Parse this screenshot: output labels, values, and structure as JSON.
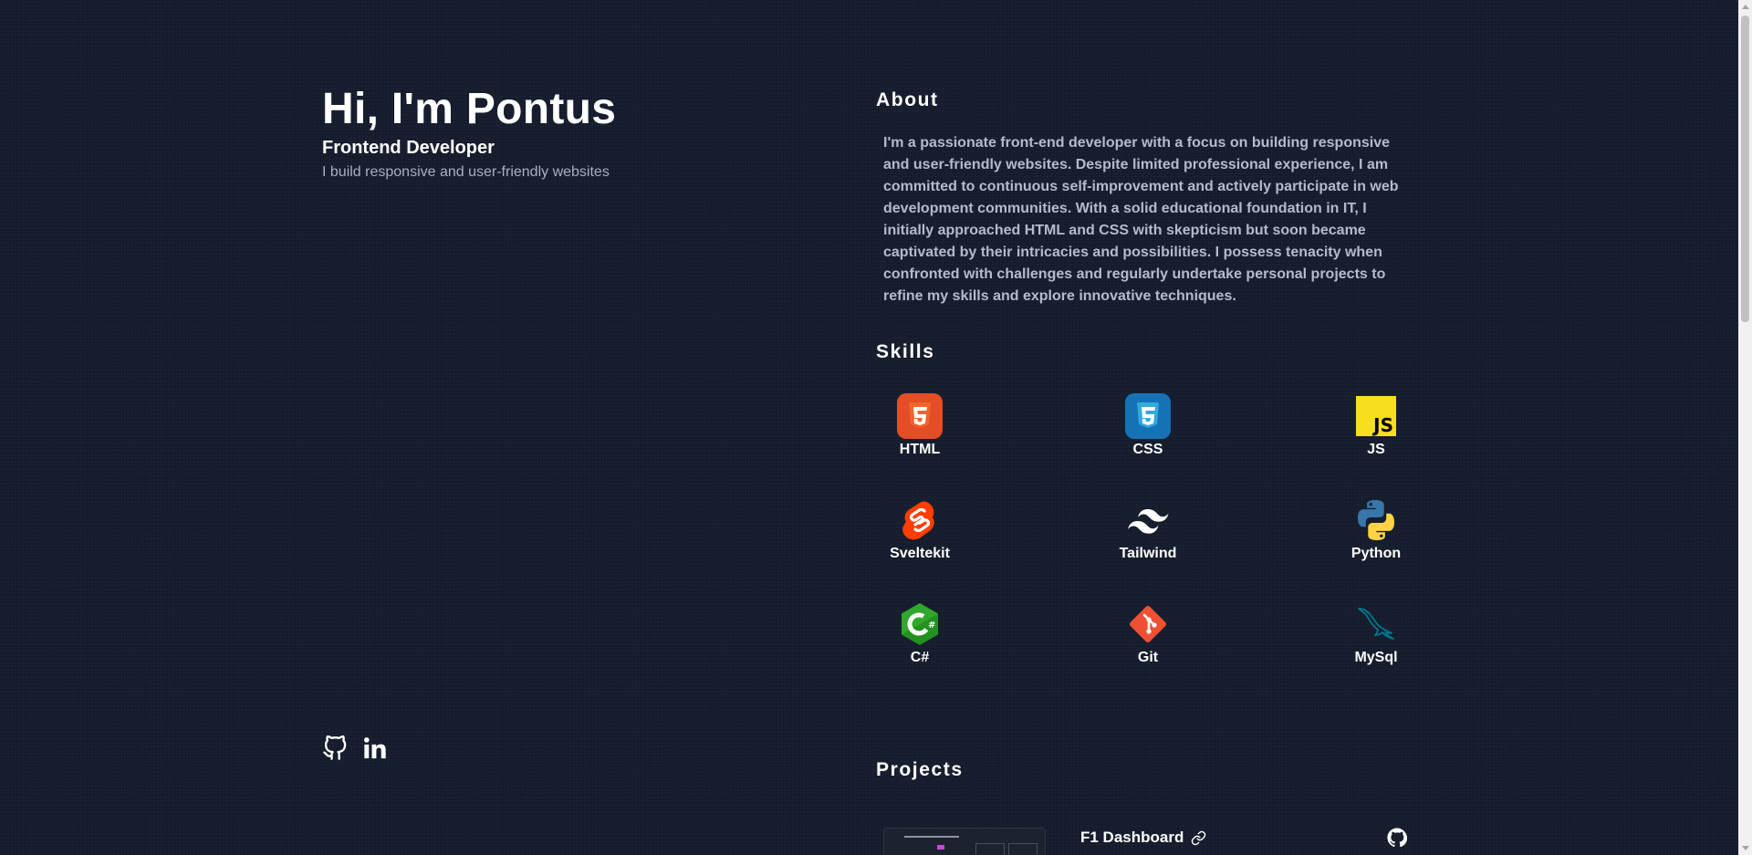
{
  "hero": {
    "title": "Hi, I'm Pontus",
    "role": "Frontend Developer",
    "tagline": "I build responsive and user-friendly websites"
  },
  "socials": [
    {
      "name": "github-icon"
    },
    {
      "name": "linkedin-icon"
    }
  ],
  "about": {
    "heading": "About",
    "text": "I'm a passionate front-end developer with a focus on building responsive and user-friendly websites. Despite limited professional experience, I am committed to continuous self-improvement and actively participate in web development communities. With a solid educational foundation in IT, I initially approached HTML and CSS with skepticism but soon became captivated by their intricacies and possibilities. I possess tenacity when confronted with challenges and regularly undertake personal projects to refine my skills and explore innovative techniques."
  },
  "skills": {
    "heading": "Skills",
    "items": [
      {
        "label": "HTML",
        "icon": "html5-icon",
        "color": "#e44d26"
      },
      {
        "label": "CSS",
        "icon": "css3-icon",
        "color": "#1572b6"
      },
      {
        "label": "JS",
        "icon": "javascript-icon",
        "color": "#f7df1e"
      },
      {
        "label": "Sveltekit",
        "icon": "svelte-icon",
        "color": "#ff3e00"
      },
      {
        "label": "Tailwind",
        "icon": "tailwind-icon",
        "color": "#ffffff"
      },
      {
        "label": "Python",
        "icon": "python-icon",
        "color": "#3776ab"
      },
      {
        "label": "C#",
        "icon": "csharp-icon",
        "color": "#239120"
      },
      {
        "label": "Git",
        "icon": "git-icon",
        "color": "#f05032"
      },
      {
        "label": "MySql",
        "icon": "mysql-icon",
        "color": "#00758f"
      }
    ]
  },
  "projects": {
    "heading": "Projects",
    "items": [
      {
        "title": "F1 Dashboard"
      }
    ]
  }
}
